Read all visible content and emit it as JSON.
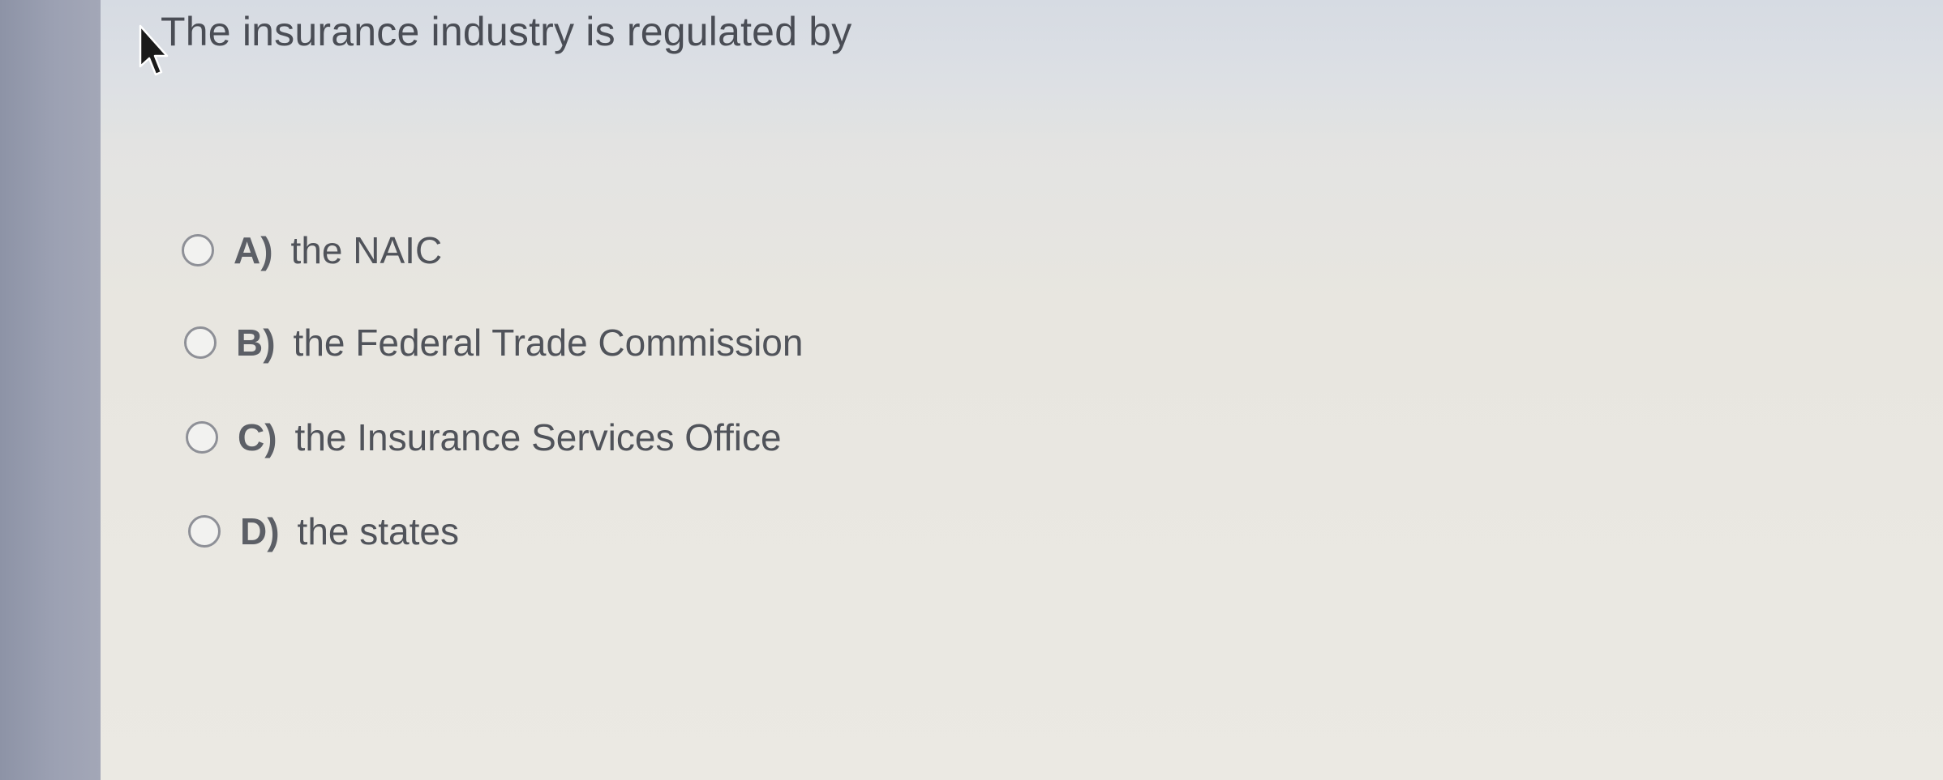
{
  "question": {
    "text": "The insurance industry is regulated by"
  },
  "options": [
    {
      "letter": "A)",
      "text": "the NAIC"
    },
    {
      "letter": "B)",
      "text": "the Federal Trade Commission"
    },
    {
      "letter": "C)",
      "text": "the Insurance Services Office"
    },
    {
      "letter": "D)",
      "text": "the states"
    }
  ],
  "colors": {
    "left_rail": "#9ca1b3",
    "background": "#e9e7e1",
    "text": "#4a4d55"
  },
  "icons": {
    "cursor": "mouse-pointer-icon",
    "radio": "radio-button-icon"
  }
}
